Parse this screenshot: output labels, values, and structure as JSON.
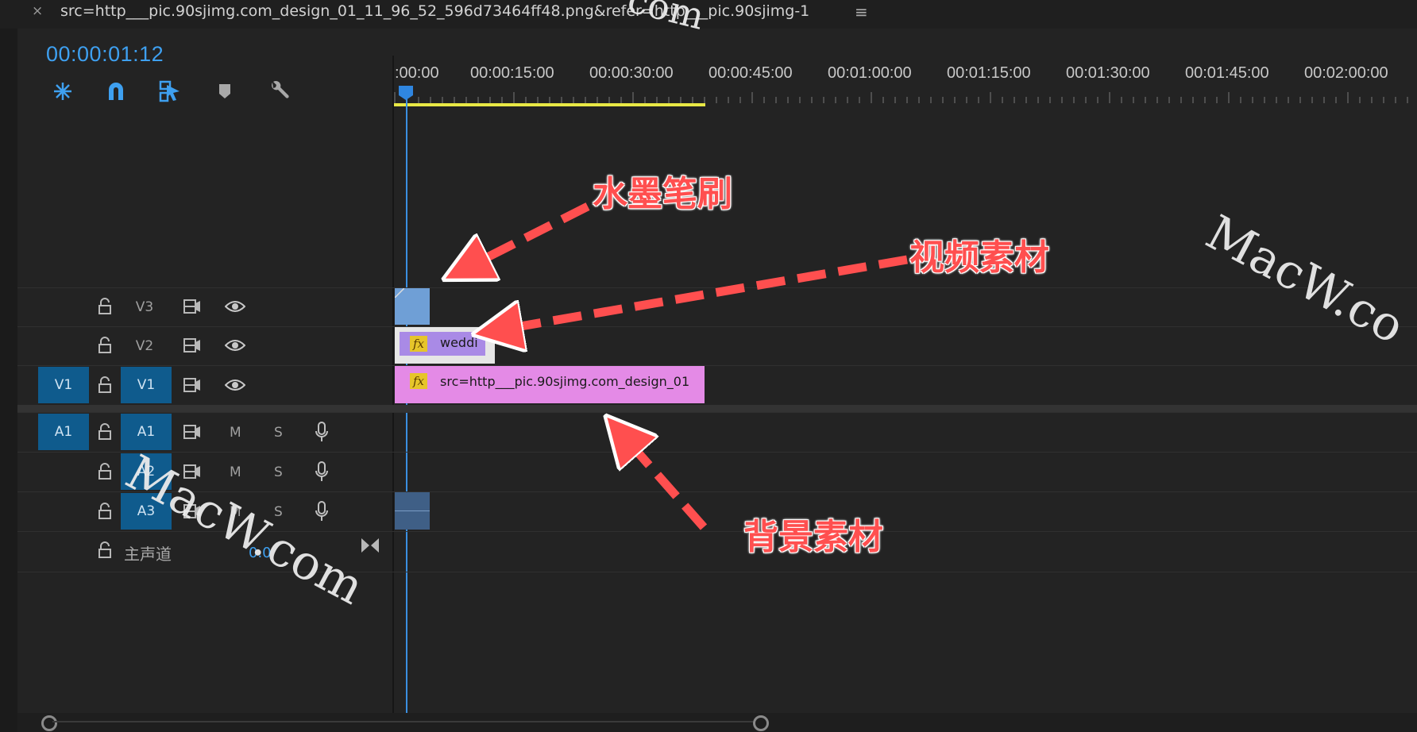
{
  "window": {
    "close_glyph": "×",
    "tab_title": "src=http___pic.90sjimg.com_design_01_11_96_52_596d73464ff48.png&refer=http___pic.90sjimg-1",
    "menu_glyph": "≡"
  },
  "header": {
    "timecode": "00:00:01:12",
    "tools": [
      "nest-sequence-icon",
      "snap-magnet-icon",
      "linked-selection-icon",
      "add-marker-icon",
      "wrench-settings-icon"
    ]
  },
  "ruler": {
    "labels": [
      ":00:00",
      "00:00:15:00",
      "00:00:30:00",
      "00:00:45:00",
      "00:01:00:00",
      "00:01:15:00",
      "00:01:30:00",
      "00:01:45:00",
      "00:02:00:00"
    ]
  },
  "tracks": {
    "v3": {
      "label": "V3"
    },
    "v2": {
      "label": "V2"
    },
    "v1": {
      "source": "V1",
      "label": "V1"
    },
    "a1": {
      "source": "A1",
      "label": "A1",
      "m": "M",
      "s": "S"
    },
    "a2": {
      "label": "A2",
      "m": "M",
      "s": "S"
    },
    "a3": {
      "label": "A3",
      "m": "M",
      "s": "S"
    },
    "master": {
      "label": "主声道",
      "value": "0.0"
    }
  },
  "clips": {
    "v2_clip": {
      "fx": "fx",
      "name": "weddi",
      "color": "#a98ae6"
    },
    "v1_clip": {
      "fx": "fx",
      "name": "src=http___pic.90sjimg.com_design_01",
      "color": "#e48ae6"
    },
    "v3_clip": {
      "color": "#6f9fd6"
    },
    "a3_clip": {
      "color": "#3f5f86"
    }
  },
  "annotations": {
    "ink_brush": "水墨笔刷",
    "video_material": "视频素材",
    "background_material": "背景素材"
  },
  "watermarks": {
    "top": "com",
    "right": "MacW.co",
    "left": "MacW.com"
  },
  "colors": {
    "accent_blue": "#3ea0f0",
    "track_pill": "#0f5b8d",
    "work_area": "#e8e845",
    "callout_red": "#ff4f4f"
  }
}
